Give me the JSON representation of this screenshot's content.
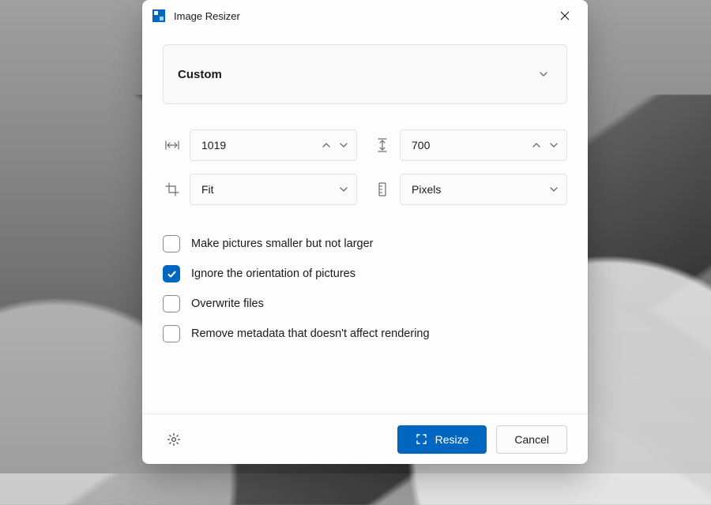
{
  "title": "Image Resizer",
  "profile": {
    "label": "Custom"
  },
  "width": {
    "value": "1019"
  },
  "height": {
    "value": "700"
  },
  "fit": {
    "label": "Fit"
  },
  "unit": {
    "label": "Pixels"
  },
  "options": {
    "smaller_only": {
      "label": "Make pictures smaller but not larger",
      "checked": false
    },
    "ignore_orientation": {
      "label": "Ignore the orientation of pictures",
      "checked": true
    },
    "overwrite": {
      "label": "Overwrite files",
      "checked": false
    },
    "remove_meta": {
      "label": "Remove metadata that doesn't affect rendering",
      "checked": false
    }
  },
  "footer": {
    "resize": "Resize",
    "cancel": "Cancel"
  },
  "colors": {
    "accent": "#0067c0"
  }
}
